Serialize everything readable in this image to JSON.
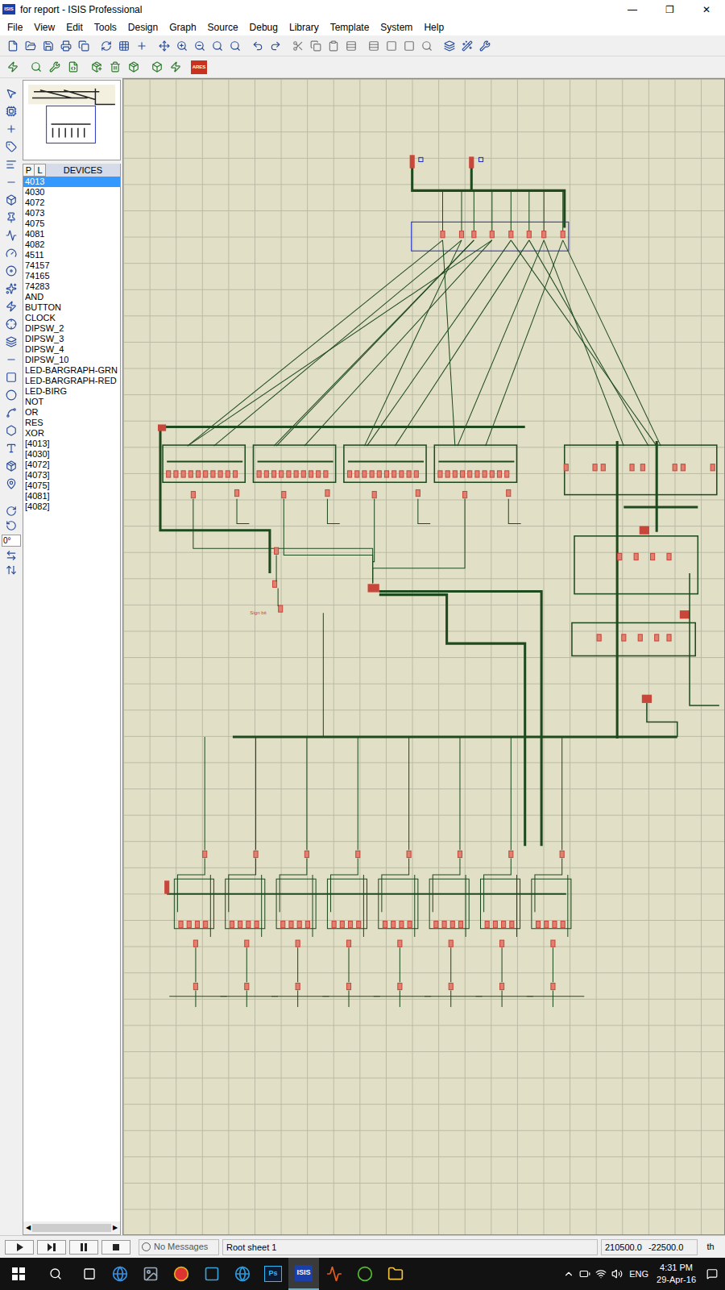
{
  "window": {
    "title": "for report - ISIS Professional",
    "app_icon": "ISIS",
    "controls": [
      "—",
      "❐",
      "✕"
    ]
  },
  "menu": [
    "File",
    "View",
    "Edit",
    "Tools",
    "Design",
    "Graph",
    "Source",
    "Debug",
    "Library",
    "Template",
    "System",
    "Help"
  ],
  "toolbar_badge": "ARES",
  "object_selector": {
    "tabs": [
      {
        "label": "P",
        "selected": false
      },
      {
        "label": "L",
        "selected": false
      }
    ],
    "title": "DEVICES",
    "items": [
      {
        "label": "4013",
        "selected": true
      },
      {
        "label": "4030",
        "selected": false
      },
      {
        "label": "4072",
        "selected": false
      },
      {
        "label": "4073",
        "selected": false
      },
      {
        "label": "4075",
        "selected": false
      },
      {
        "label": "4081",
        "selected": false
      },
      {
        "label": "4082",
        "selected": false
      },
      {
        "label": "4511",
        "selected": false
      },
      {
        "label": "74157",
        "selected": false
      },
      {
        "label": "74165",
        "selected": false
      },
      {
        "label": "74283",
        "selected": false
      },
      {
        "label": "AND",
        "selected": false
      },
      {
        "label": "BUTTON",
        "selected": false
      },
      {
        "label": "CLOCK",
        "selected": false
      },
      {
        "label": "DIPSW_2",
        "selected": false
      },
      {
        "label": "DIPSW_3",
        "selected": false
      },
      {
        "label": "DIPSW_4",
        "selected": false
      },
      {
        "label": "DIPSW_10",
        "selected": false
      },
      {
        "label": "LED-BARGRAPH-GRN",
        "selected": false
      },
      {
        "label": "LED-BARGRAPH-RED",
        "selected": false
      },
      {
        "label": "LED-BIRG",
        "selected": false
      },
      {
        "label": "NOT",
        "selected": false
      },
      {
        "label": "OR",
        "selected": false
      },
      {
        "label": "RES",
        "selected": false
      },
      {
        "label": "XOR",
        "selected": false
      },
      {
        "label": "[4013]",
        "selected": false
      },
      {
        "label": "[4030]",
        "selected": false
      },
      {
        "label": "[4072]",
        "selected": false
      },
      {
        "label": "[4073]",
        "selected": false
      },
      {
        "label": "[4075]",
        "selected": false
      },
      {
        "label": "[4081]",
        "selected": false
      },
      {
        "label": "[4082]",
        "selected": false
      }
    ]
  },
  "rotation": "0°",
  "schematic": {
    "labels": [
      "Sign bit"
    ]
  },
  "status_bar": {
    "message": "No Messages",
    "sheet": "Root sheet 1",
    "x": "210500.0",
    "y": "-22500.0",
    "units": "th"
  },
  "taskbar": {
    "apps": [
      {
        "label": "Ps",
        "selected": false
      },
      {
        "label": "ISIS",
        "selected": true
      }
    ],
    "language": "ENG",
    "time": "4:31 PM",
    "date": "29-Apr-16"
  }
}
